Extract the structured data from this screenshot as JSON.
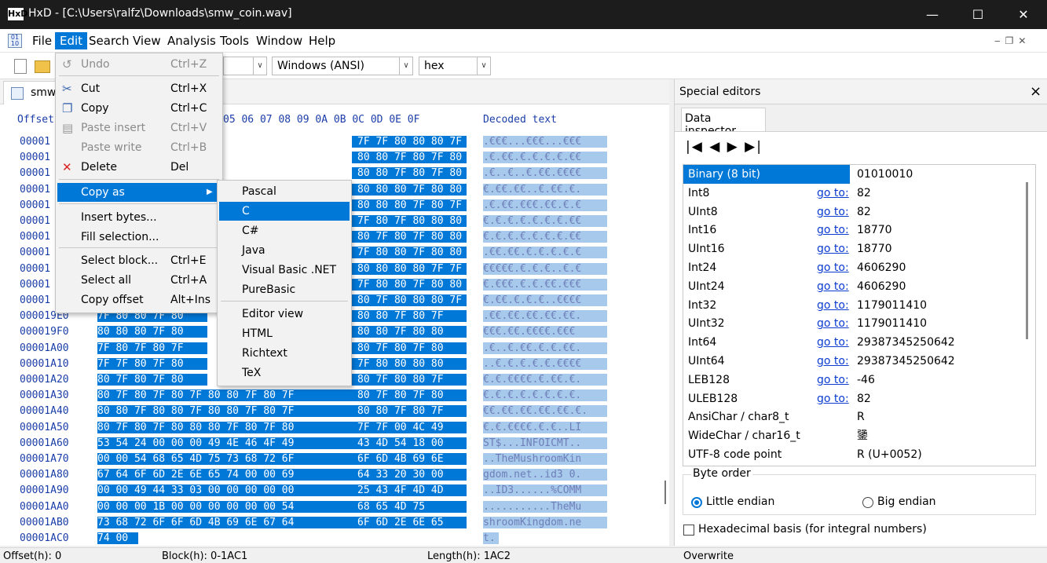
{
  "window": {
    "title": "HxD - [C:\\Users\\ralfz\\Downloads\\smw_coin.wav]",
    "logo_text": "HxD",
    "minimize": "—",
    "maximize": "☐",
    "close": "✕"
  },
  "menubar": [
    "File",
    "Edit",
    "Search",
    "View",
    "Analysis",
    "Tools",
    "Window",
    "Help"
  ],
  "toolbar": {
    "encoding": "Windows (ANSI)",
    "mode": "hex"
  },
  "file_tab": "smw",
  "hex": {
    "offset_header": "Offset(h)",
    "col_header": "05 06 07 08 09 0A 0B 0C 0D 0E 0F",
    "decoded_header": "Decoded text",
    "rows": [
      {
        "off": "00001",
        "hex": "7F 7F 80 80 80 7F 7F 7F 80 80 80",
        "txt": ".€€€...€€€...€€€"
      },
      {
        "off": "00001",
        "hex": "80 80 7F 80 7F 80 7F 80 7F 80 80",
        "txt": ".€.€€.€.€.€.€.€€"
      },
      {
        "off": "00001",
        "hex": "80 80 7F 80 7F 80 80 7F 80 80 80",
        "txt": ".€..€..€.€€.€€€€"
      },
      {
        "off": "00001",
        "hex": "80 80 80 7F 80 80 80 80 7F 80 7F",
        "txt": "€.€€.€€..€.€€.€."
      },
      {
        "off": "00001",
        "hex": "80 80 80 7F 80 7F 7F 80 7F 80 7F",
        "txt": ".€.€€.€€€.€€.€.€"
      },
      {
        "off": "00001",
        "hex": "7F 80 7F 80 80 80 7F 80 7F 80 80",
        "txt": "€.€.€.€.€.€.€.€€"
      },
      {
        "off": "00001",
        "hex": "80 7F 80 7F 80 80 7F 80 7F 80 80",
        "txt": "€.€.€.€.€.€.€.€€"
      },
      {
        "off": "00001",
        "hex": "7F 80 80 7F 80 80 80 7F 80 7F 80",
        "txt": ".€€.€€.€.€.€.€.€"
      },
      {
        "off": "00001",
        "hex": "80 80 80 80 7F 7F 7F 7F 80 7F 80",
        "txt": "€€€€€.€.€.€..€.€"
      },
      {
        "off": "00001",
        "hex": "7F 80 80 7F 80 80 80 7F 80 80 80",
        "txt": "€.€€€.€.€.€€.€€€"
      },
      {
        "off": "00001",
        "hex": "80 7F 80 80 80 7F 80 80 80 80 80",
        "txt": "€.€€.€.€.€..€€€€"
      },
      {
        "off": "000019E0",
        "hex": "7F 80 80 7F 80",
        "hex2": "80 80 7F 80 7F",
        "txt": ".€€.€€.€€.€€.€€."
      },
      {
        "off": "000019F0",
        "hex": "80 80 80 7F 80",
        "hex2": "80 80 7F 80 80",
        "txt": "€€€.€€.€€€€.€€€"
      },
      {
        "off": "00001A00",
        "hex": "7F 80 7F 80 7F",
        "hex2": "80 7F 80 7F 80",
        "txt": ".€..€.€€.€.€.€€."
      },
      {
        "off": "00001A10",
        "hex": "7F 7F 80 7F 80",
        "hex2": "7F 80 80 80 80",
        "txt": "..€.€.€.€.€.€€€€"
      },
      {
        "off": "00001A20",
        "hex": "80 7F 80 7F 80",
        "hex2": "80 7F 80 80 7F",
        "txt": "€.€.€€€€.€.€€.€."
      },
      {
        "off": "00001A30",
        "hex": "80 7F 80 7F 80 7F 80 80 7F 80 7F",
        "hex3": "80 7F 80 7F 80",
        "txt": "€.€.€.€.€.€.€.€."
      },
      {
        "off": "00001A40",
        "hex": "80 80 7F 80 80 7F 80 80 7F 80 7F",
        "hex3": "80 80 7F 80 7F",
        "txt": "€€.€€.€€.€€.€€.€."
      },
      {
        "off": "00001A50",
        "hex": "80 7F 80 7F 80 80 80 7F 80 7F 80",
        "hex3": "7F 7F 00 4C 49",
        "txt": "€.€.€€€€.€.€..LI"
      },
      {
        "off": "00001A60",
        "hex": "53 54 24 00 00 00 49 4E 46 4F 49",
        "hex3": "43 4D 54 18 00",
        "txt": "ST$...INFOICMT.."
      },
      {
        "off": "00001A70",
        "hex": "00 00 54 68 65 4D 75 73 68 72 6F",
        "hex3": "6F 6D 4B 69 6E",
        "txt": "..TheMushroomKin"
      },
      {
        "off": "00001A80",
        "hex": "67 64 6F 6D 2E 6E 65 74 00 00 69",
        "hex3": "64 33 20 30 00",
        "txt": "gdom.net..id3 0."
      },
      {
        "off": "00001A90",
        "hex": "00 00 49 44 33 03 00 00 00 00 00",
        "hex3": "25 43 4F 4D 4D",
        "txt": "..ID3......%COMM"
      },
      {
        "off": "00001AA0",
        "hex": "00 00 00 1B 00 00 00 00 00 00 54",
        "hex3": "68 65 4D 75",
        "txt": "...........TheMu"
      },
      {
        "off": "00001AB0",
        "hex": "73 68 72 6F 6F 6D 4B 69 6E 67 64",
        "hex3": "6F 6D 2E 6E 65",
        "txt": "shroomKingdom.ne"
      },
      {
        "off": "00001AC0",
        "hex": "74 00",
        "txt": "t."
      }
    ]
  },
  "edit_menu": [
    {
      "label": "Undo",
      "shortcut": "Ctrl+Z",
      "disabled": true
    },
    {
      "label": "Cut",
      "shortcut": "Ctrl+X"
    },
    {
      "label": "Copy",
      "shortcut": "Ctrl+C"
    },
    {
      "label": "Paste insert",
      "shortcut": "Ctrl+V",
      "disabled": true
    },
    {
      "label": "Paste write",
      "shortcut": "Ctrl+B",
      "disabled": true
    },
    {
      "label": "Delete",
      "shortcut": "Del"
    },
    {
      "label": "Copy as",
      "shortcut": ""
    },
    {
      "label": "Insert bytes...",
      "shortcut": ""
    },
    {
      "label": "Fill selection...",
      "shortcut": ""
    },
    {
      "label": "Select block...",
      "shortcut": "Ctrl+E"
    },
    {
      "label": "Select all",
      "shortcut": "Ctrl+A"
    },
    {
      "label": "Copy offset",
      "shortcut": "Alt+Ins"
    }
  ],
  "copy_as_menu": [
    "Pascal",
    "C",
    "C#",
    "Java",
    "Visual Basic .NET",
    "PureBasic",
    "Editor view",
    "HTML",
    "Richtext",
    "TeX"
  ],
  "special_editors": {
    "title": "Special editors",
    "close": "×",
    "tab": "Data inspector",
    "nav": "|◀ ◀ ▶ ▶|",
    "go_to": "go to:",
    "rows": [
      {
        "name": "Binary (8 bit)",
        "value": "01010010",
        "go": false
      },
      {
        "name": "Int8",
        "value": "82",
        "go": true
      },
      {
        "name": "UInt8",
        "value": "82",
        "go": true
      },
      {
        "name": "Int16",
        "value": "18770",
        "go": true
      },
      {
        "name": "UInt16",
        "value": "18770",
        "go": true
      },
      {
        "name": "Int24",
        "value": "4606290",
        "go": true
      },
      {
        "name": "UInt24",
        "value": "4606290",
        "go": true
      },
      {
        "name": "Int32",
        "value": "1179011410",
        "go": true
      },
      {
        "name": "UInt32",
        "value": "1179011410",
        "go": true
      },
      {
        "name": "Int64",
        "value": "29387345250642",
        "go": true
      },
      {
        "name": "UInt64",
        "value": "29387345250642",
        "go": true
      },
      {
        "name": "LEB128",
        "value": "-46",
        "go": true
      },
      {
        "name": "ULEB128",
        "value": "82",
        "go": true
      },
      {
        "name": "AnsiChar / char8_t",
        "value": "R",
        "go": false
      },
      {
        "name": "WideChar / char16_t",
        "value": "䥒",
        "go": false
      },
      {
        "name": "UTF-8 code point",
        "value": "R (U+0052)",
        "go": false
      }
    ],
    "byte_order_label": "Byte order",
    "little_endian": "Little endian",
    "big_endian": "Big endian",
    "hex_basis": "Hexadecimal basis (for integral numbers)"
  },
  "status": {
    "offset": "Offset(h): 0",
    "block": "Block(h): 0-1AC1",
    "length": "Length(h): 1AC2",
    "mode": "Overwrite"
  }
}
